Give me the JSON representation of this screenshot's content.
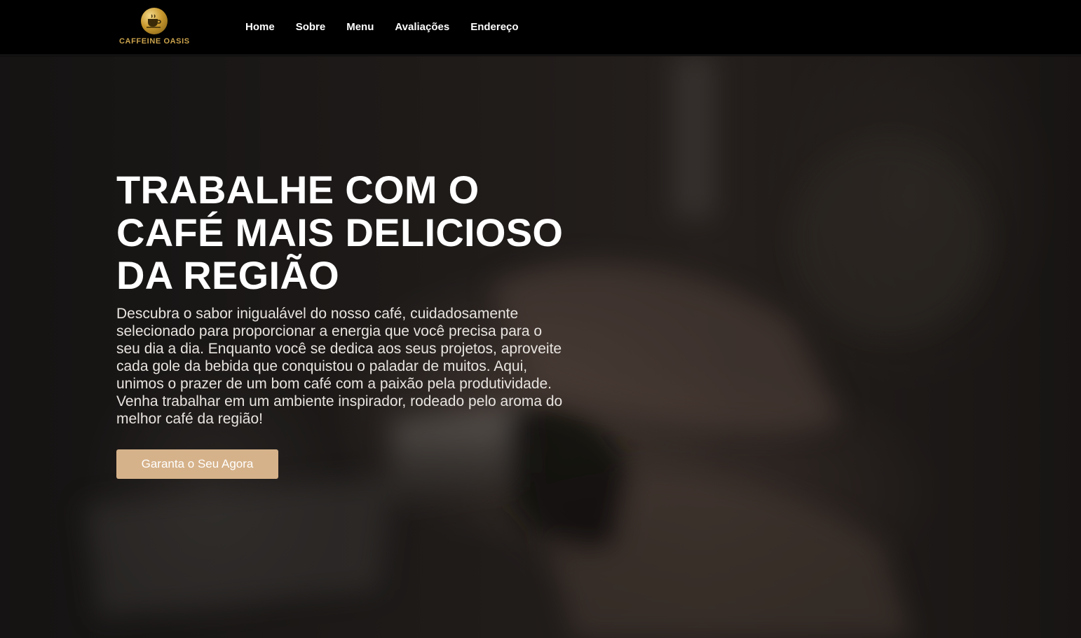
{
  "brand": {
    "name": "CAFFEINE OASIS",
    "icon": "coffee-cup-icon",
    "color": "#caa24c"
  },
  "nav": {
    "items": [
      {
        "label": "Home"
      },
      {
        "label": "Sobre"
      },
      {
        "label": "Menu"
      },
      {
        "label": "Avaliações"
      },
      {
        "label": "Endereço"
      }
    ]
  },
  "hero": {
    "title_lines": [
      "TRABALHE COM O",
      "CAFÉ MAIS DELICIOSO",
      "DA REGIÃO"
    ],
    "description": "Descubra o sabor inigualável do nosso café, cuidadosamente selecionado para proporcionar a energia que você precisa para o seu dia a dia. Enquanto você se dedica aos seus projetos, aproveite cada gole da bebida que conquistou o paladar de muitos. Aqui, unimos o prazer de um bom café com a paixão pela produtividade. Venha trabalhar em um ambiente inspirador, rodeado pelo aroma do melhor café da região!",
    "cta_label": "Garanta o Seu Agora",
    "cta_color": "#d6b28a"
  }
}
